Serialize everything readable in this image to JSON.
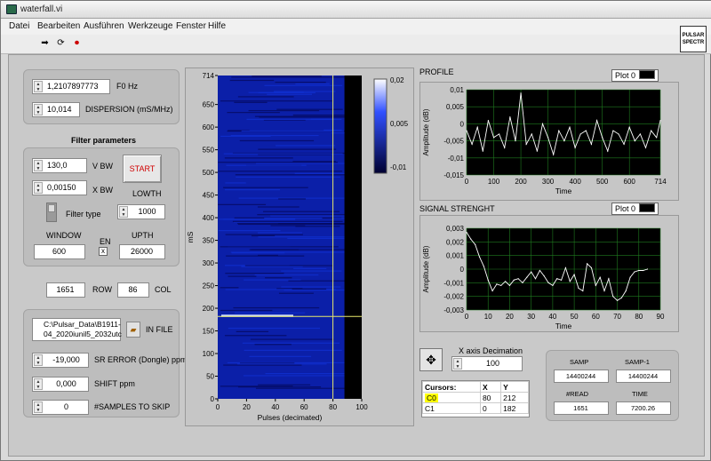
{
  "window": {
    "title": "waterfall.vi",
    "icon_label": "PULSAR SPECTR"
  },
  "menu": {
    "items": [
      "Datei",
      "Bearbeiten",
      "Ausführen",
      "Werkzeuge",
      "Fenster",
      "Hilfe"
    ]
  },
  "toolbar": {
    "icons": [
      "run-arrow-icon",
      "run-continuous-icon",
      "abort-icon"
    ]
  },
  "controls": {
    "f0": {
      "value": "1,2107897773",
      "label": "F0 Hz"
    },
    "dispersion": {
      "value": "10,014",
      "label": "DISPERSION (mS/MHz)"
    },
    "filter_title": "Filter parameters",
    "vbw": {
      "value": "130,0",
      "label": "V BW"
    },
    "xbw": {
      "value": "0,00150",
      "label": "X BW"
    },
    "start_label": "START",
    "lowth": {
      "label": "LOWTH",
      "value": "1000"
    },
    "filter_type_label": "Filter type",
    "window": {
      "label": "WINDOW",
      "value": "600"
    },
    "en": {
      "label": "EN",
      "mark": "x"
    },
    "upth": {
      "label": "UPTH",
      "value": "26000"
    },
    "row": {
      "value": "1651",
      "label": "ROW"
    },
    "col": {
      "value": "86",
      "label": "COL"
    },
    "infile": {
      "line1": "C:\\Pulsar_Data\\B1911-",
      "line2": "04_2020iunil5_2032utc",
      "label": "IN FILE"
    },
    "sr_error": {
      "value": "-19,000",
      "label": "SR ERROR (Dongle) ppm"
    },
    "shift": {
      "value": "0,000",
      "label": "SHIFT ppm"
    },
    "skip": {
      "value": "0",
      "label": "#SAMPLES TO SKIP"
    },
    "xdec": {
      "label": "X axis Decimation",
      "value": "100"
    }
  },
  "cursors": {
    "header": [
      "Cursors:",
      "X",
      "Y"
    ],
    "rows": [
      {
        "name": "C0",
        "x": "80",
        "y": "212"
      },
      {
        "name": "C1",
        "x": "0",
        "y": "182"
      }
    ]
  },
  "stats": {
    "samp": {
      "label": "SAMP",
      "value": "14400244"
    },
    "samp1": {
      "label": "SAMP-1",
      "value": "14400244"
    },
    "read": {
      "label": "#READ",
      "value": "1651"
    },
    "time": {
      "label": "TIME",
      "value": "7200.26"
    }
  },
  "colors": {
    "plot_bg": "#000000",
    "plot_grid": "#1f7a1f",
    "trace": "#ffffff",
    "waterfall": "#0b1fa8",
    "cursor": "#e8e86a",
    "start_text": "#d00000"
  },
  "chart_data": [
    {
      "type": "heatmap",
      "name": "waterfall",
      "xlabel": "Pulses (decimated)",
      "ylabel": "mS",
      "xlim": [
        0,
        100
      ],
      "ylim": [
        0,
        714
      ],
      "xticks": [
        "0",
        "20",
        "40",
        "60",
        "80",
        "100"
      ],
      "yticks": [
        "0",
        "50",
        "100",
        "150",
        "200",
        "250",
        "300",
        "350",
        "400",
        "450",
        "500",
        "550",
        "600",
        "650",
        "714"
      ],
      "colorbar_ticks": [
        "0,02",
        "0,005",
        "-0,01"
      ],
      "cursor_x": 80,
      "cursor_y": 182
    },
    {
      "type": "line",
      "title": "PROFILE",
      "legend": "Plot 0",
      "xlabel": "Time",
      "ylabel": "Amplitude (dB)",
      "xlim": [
        0,
        714
      ],
      "ylim": [
        -0.015,
        0.01
      ],
      "xticks": [
        "0",
        "100",
        "200",
        "300",
        "400",
        "500",
        "600",
        "714"
      ],
      "yticks": [
        "0,01",
        "0,005",
        "0",
        "-0,005",
        "-0,01",
        "-0,015"
      ],
      "x": [
        0,
        20,
        40,
        60,
        80,
        100,
        120,
        140,
        160,
        180,
        200,
        220,
        240,
        260,
        280,
        300,
        320,
        340,
        360,
        380,
        400,
        420,
        440,
        460,
        480,
        500,
        520,
        540,
        560,
        580,
        600,
        620,
        640,
        660,
        680,
        700,
        714
      ],
      "y": [
        -0.002,
        -0.006,
        -0.001,
        -0.008,
        0.001,
        -0.004,
        -0.003,
        -0.007,
        0.002,
        -0.005,
        0.009,
        -0.006,
        -0.003,
        -0.008,
        0.0,
        -0.004,
        -0.009,
        -0.002,
        -0.005,
        -0.001,
        -0.007,
        -0.003,
        -0.002,
        -0.006,
        0.001,
        -0.004,
        -0.008,
        -0.002,
        -0.003,
        -0.006,
        -0.001,
        -0.005,
        -0.003,
        -0.007,
        -0.002,
        -0.004,
        0.001
      ]
    },
    {
      "type": "line",
      "title": "SIGNAL STRENGHT",
      "legend": "Plot 0",
      "xlabel": "Time",
      "ylabel": "Amplitude (dB)",
      "xlim": [
        0,
        90
      ],
      "ylim": [
        -0.003,
        0.003
      ],
      "xticks": [
        "0",
        "10",
        "20",
        "30",
        "40",
        "50",
        "60",
        "70",
        "80",
        "90"
      ],
      "yticks": [
        "0,003",
        "0,002",
        "0,001",
        "0",
        "-0,001",
        "-0,002",
        "-0,003"
      ],
      "x": [
        0,
        2,
        4,
        6,
        8,
        10,
        12,
        14,
        16,
        18,
        20,
        22,
        24,
        26,
        28,
        30,
        32,
        34,
        36,
        38,
        40,
        42,
        44,
        46,
        48,
        50,
        52,
        54,
        56,
        58,
        60,
        62,
        64,
        66,
        68,
        70,
        72,
        74,
        76,
        78,
        80,
        82,
        84
      ],
      "y": [
        0.0027,
        0.0022,
        0.0018,
        0.0009,
        0.0002,
        -0.0008,
        -0.0016,
        -0.0011,
        -0.0012,
        -0.0009,
        -0.0012,
        -0.0008,
        -0.0007,
        -0.001,
        -0.0006,
        -0.0002,
        -0.0007,
        -0.0001,
        -0.0005,
        -0.001,
        -0.0012,
        -0.0007,
        -0.0008,
        0.0001,
        -0.0009,
        -0.0004,
        -0.0014,
        -0.0016,
        0.0004,
        0.0001,
        -0.0012,
        -0.0006,
        -0.0016,
        -0.0007,
        -0.002,
        -0.0023,
        -0.0021,
        -0.0016,
        -0.0006,
        -0.0002,
        -0.0001,
        -0.0001,
        0.0
      ]
    }
  ]
}
